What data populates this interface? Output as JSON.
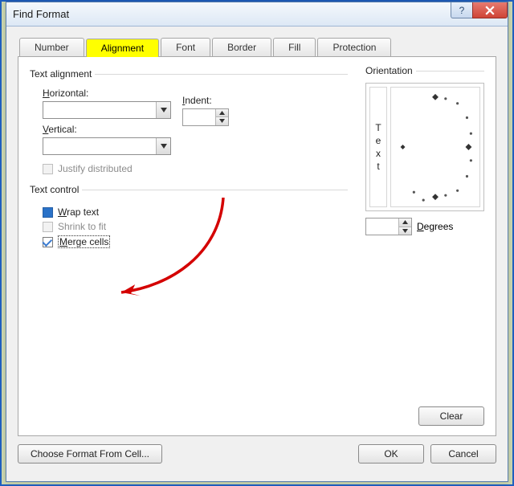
{
  "window": {
    "title": "Find Format"
  },
  "tabs": [
    "Number",
    "Alignment",
    "Font",
    "Border",
    "Fill",
    "Protection"
  ],
  "active_tab_index": 1,
  "alignment": {
    "group_text_alignment": "Text alignment",
    "horizontal_label": "Horizontal:",
    "horizontal_value": "",
    "indent_label": "Indent:",
    "indent_value": "",
    "vertical_label": "Vertical:",
    "vertical_value": "",
    "justify_distributed": "Justify distributed",
    "group_text_control": "Text control",
    "wrap_text": "Wrap text",
    "shrink_to_fit": "Shrink to fit",
    "merge_cells": "Merge cells"
  },
  "orientation": {
    "legend": "Orientation",
    "vtext": [
      "T",
      "e",
      "x",
      "t"
    ],
    "degrees_label": "Degrees",
    "degrees_value": ""
  },
  "buttons": {
    "clear": "Clear",
    "choose_from_cell": "Choose Format From Cell...",
    "ok": "OK",
    "cancel": "Cancel"
  }
}
